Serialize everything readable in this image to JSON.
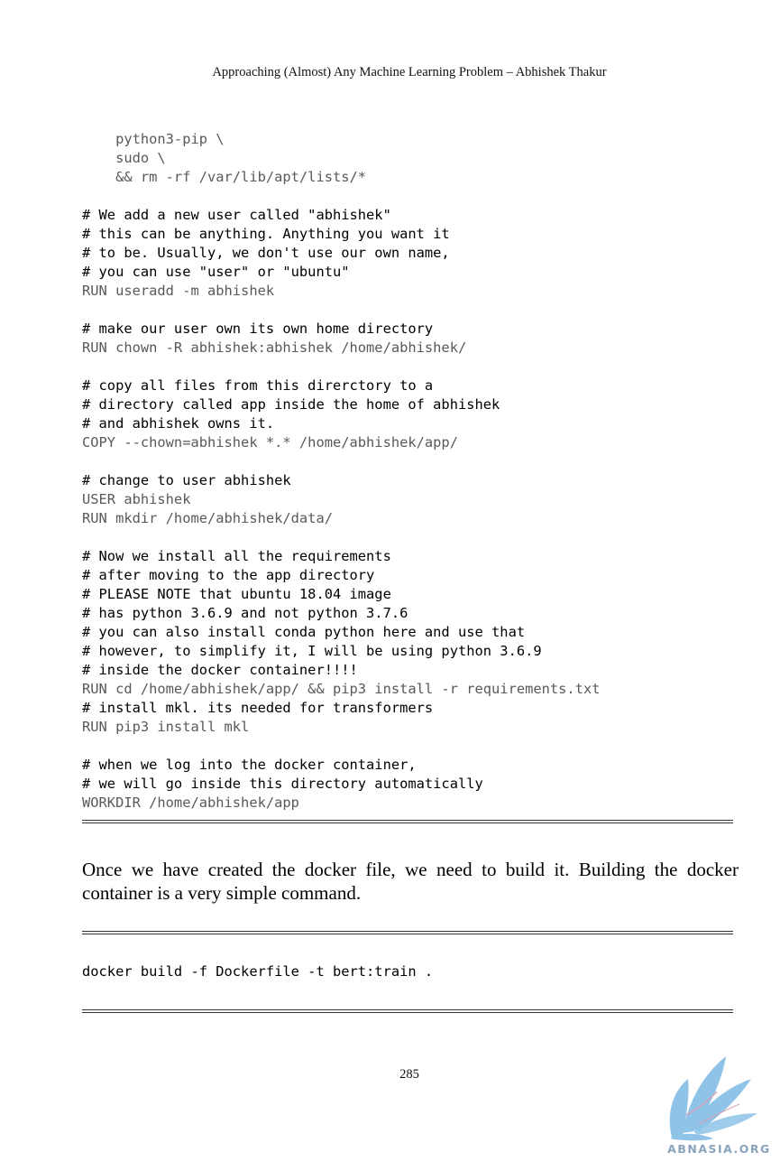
{
  "header": {
    "running_title": "Approaching (Almost) Any Machine Learning Problem – Abhishek Thakur"
  },
  "code_block_1": {
    "lines": [
      {
        "text": "    python3-pip \\",
        "kind": "keyword"
      },
      {
        "text": "    sudo \\",
        "kind": "keyword"
      },
      {
        "text": "    && rm -rf /var/lib/apt/lists/*",
        "kind": "keyword"
      },
      {
        "text": "",
        "kind": "blank"
      },
      {
        "text": "# We add a new user called \"abhishek\"",
        "kind": "comment"
      },
      {
        "text": "# this can be anything. Anything you want it",
        "kind": "comment"
      },
      {
        "text": "# to be. Usually, we don't use our own name,",
        "kind": "comment"
      },
      {
        "text": "# you can use \"user\" or \"ubuntu\"",
        "kind": "comment"
      },
      {
        "text": "RUN useradd -m abhishek",
        "kind": "keyword"
      },
      {
        "text": "",
        "kind": "blank"
      },
      {
        "text": "# make our user own its own home directory",
        "kind": "comment"
      },
      {
        "text": "RUN chown -R abhishek:abhishek /home/abhishek/",
        "kind": "keyword"
      },
      {
        "text": "",
        "kind": "blank"
      },
      {
        "text": "# copy all files from this direrctory to a",
        "kind": "comment"
      },
      {
        "text": "# directory called app inside the home of abhishek",
        "kind": "comment"
      },
      {
        "text": "# and abhishek owns it.",
        "kind": "comment"
      },
      {
        "text": "COPY --chown=abhishek *.* /home/abhishek/app/",
        "kind": "keyword"
      },
      {
        "text": "",
        "kind": "blank"
      },
      {
        "text": "# change to user abhishek",
        "kind": "comment"
      },
      {
        "text": "USER abhishek",
        "kind": "keyword"
      },
      {
        "text": "RUN mkdir /home/abhishek/data/",
        "kind": "keyword"
      },
      {
        "text": "",
        "kind": "blank"
      },
      {
        "text": "# Now we install all the requirements",
        "kind": "comment"
      },
      {
        "text": "# after moving to the app directory",
        "kind": "comment"
      },
      {
        "text": "# PLEASE NOTE that ubuntu 18.04 image",
        "kind": "comment"
      },
      {
        "text": "# has python 3.6.9 and not python 3.7.6",
        "kind": "comment"
      },
      {
        "text": "# you can also install conda python here and use that",
        "kind": "comment"
      },
      {
        "text": "# however, to simplify it, I will be using python 3.6.9",
        "kind": "comment"
      },
      {
        "text": "# inside the docker container!!!!",
        "kind": "comment"
      },
      {
        "text": "RUN cd /home/abhishek/app/ && pip3 install -r requirements.txt",
        "kind": "keyword"
      },
      {
        "text": "# install mkl. its needed for transformers",
        "kind": "comment"
      },
      {
        "text": "RUN pip3 install mkl",
        "kind": "keyword"
      },
      {
        "text": "",
        "kind": "blank"
      },
      {
        "text": "# when we log into the docker container,",
        "kind": "comment"
      },
      {
        "text": "# we will go inside this directory automatically",
        "kind": "comment"
      },
      {
        "text": "WORKDIR /home/abhishek/app",
        "kind": "keyword"
      }
    ]
  },
  "body": {
    "paragraph": "Once we have created the docker file, we need to build it. Building the docker container is a very simple command."
  },
  "code_block_2": {
    "lines": [
      {
        "text": "docker build -f Dockerfile -t bert:train .",
        "kind": "comment"
      }
    ]
  },
  "footer": {
    "page_number": "285",
    "watermark_text": "ABNASIA.ORG"
  },
  "colors": {
    "comment_text": "#000000",
    "keyword_text": "#595959",
    "watermark": "#8fb8dc"
  }
}
